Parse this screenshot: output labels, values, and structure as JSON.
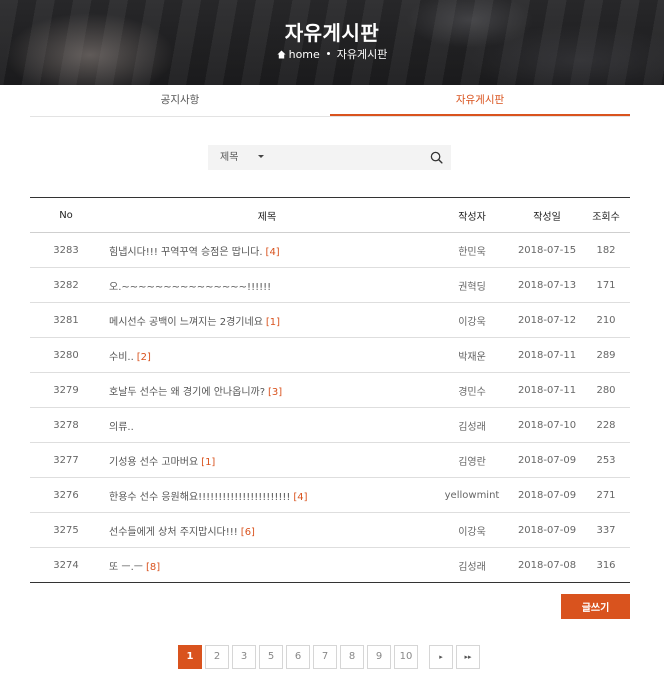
{
  "header": {
    "title": "자유게시판",
    "breadcrumb": {
      "home": "home",
      "current": "자유게시판"
    }
  },
  "tabs": [
    {
      "label": "공지사항",
      "active": false
    },
    {
      "label": "자유게시판",
      "active": true
    }
  ],
  "search": {
    "field_label": "제목",
    "value": "",
    "icon": "search-icon"
  },
  "table": {
    "columns": [
      "No",
      "제목",
      "작성자",
      "작성일",
      "조회수"
    ],
    "rows": [
      {
        "no": "3283",
        "title": "힘냅시다!!! 꾸역꾸역 승점은 땁니다.",
        "comments": "[4]",
        "author": "한민욱",
        "date": "2018-07-15",
        "views": "182"
      },
      {
        "no": "3282",
        "title": "오.~~~~~~~~~~~~~~~!!!!!!",
        "comments": "",
        "author": "권혁딩",
        "date": "2018-07-13",
        "views": "171"
      },
      {
        "no": "3281",
        "title": "메시선수 공백이 느껴지는 2경기네요",
        "comments": "[1]",
        "author": "이강욱",
        "date": "2018-07-12",
        "views": "210"
      },
      {
        "no": "3280",
        "title": "수비..",
        "comments": "[2]",
        "author": "박재운",
        "date": "2018-07-11",
        "views": "289"
      },
      {
        "no": "3279",
        "title": "호날두 선수는 왜 경기에 안나옵니까?",
        "comments": "[3]",
        "author": "경민수",
        "date": "2018-07-11",
        "views": "280"
      },
      {
        "no": "3278",
        "title": "의류..",
        "comments": "",
        "author": "김성래",
        "date": "2018-07-10",
        "views": "228"
      },
      {
        "no": "3277",
        "title": "기성용 선수 고마버요",
        "comments": "[1]",
        "author": "김영란",
        "date": "2018-07-09",
        "views": "253"
      },
      {
        "no": "3276",
        "title": "한용수 선수 응원해요!!!!!!!!!!!!!!!!!!!!!!!",
        "comments": "[4]",
        "author": "yellowmint",
        "date": "2018-07-09",
        "views": "271"
      },
      {
        "no": "3275",
        "title": "선수들에게 상처 주지맙시다!!!",
        "comments": "[6]",
        "author": "이강욱",
        "date": "2018-07-09",
        "views": "337"
      },
      {
        "no": "3274",
        "title": "또 ㅡ.ㅡ",
        "comments": "[8]",
        "author": "김성래",
        "date": "2018-07-08",
        "views": "316"
      }
    ]
  },
  "write_button": "글쓰기",
  "pagination": {
    "pages": [
      "1",
      "2",
      "3",
      "5",
      "6",
      "7",
      "8",
      "9",
      "10"
    ],
    "current": "1",
    "next_icon": "chevron-right-icon",
    "last_icon": "double-chevron-right-icon"
  },
  "colors": {
    "accent": "#d9531e",
    "hero_bg": "#1f1f21"
  }
}
